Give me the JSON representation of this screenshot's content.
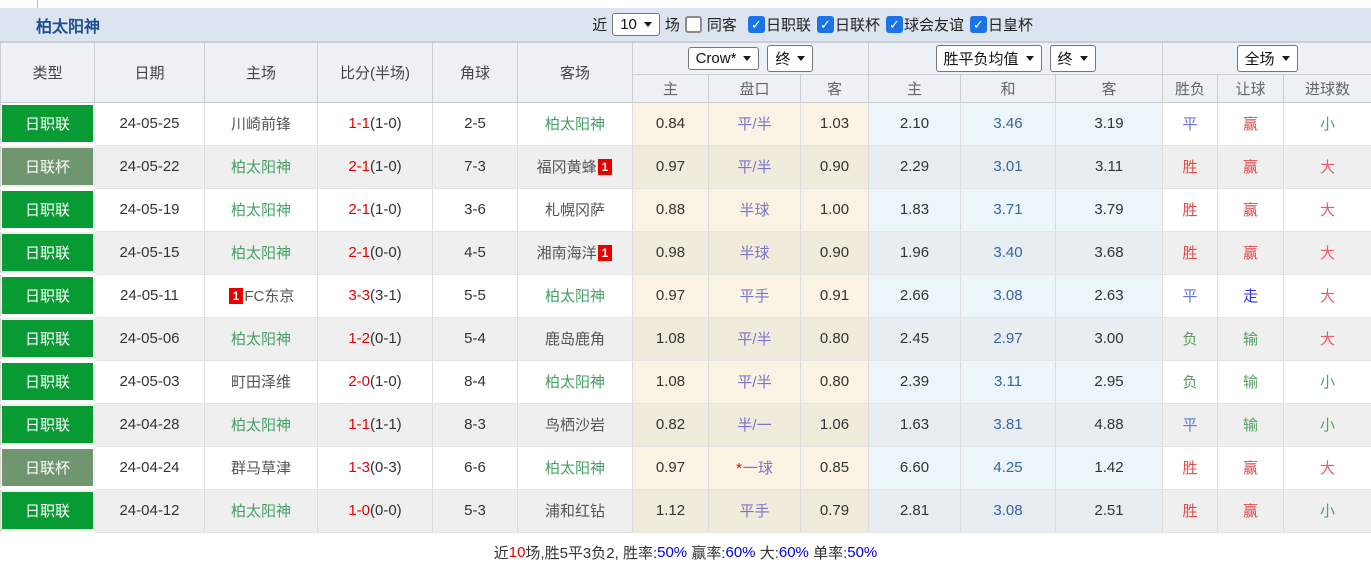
{
  "title": "柏太阳神",
  "toolbar": {
    "recent_label": "近",
    "matches_count": "10",
    "matches_label": "场",
    "same_venue_label": "同客",
    "same_venue_checked": false,
    "filters": [
      {
        "label": "日职联",
        "checked": true
      },
      {
        "label": "日联杯",
        "checked": true
      },
      {
        "label": "球会友谊",
        "checked": true
      },
      {
        "label": "日皇杯",
        "checked": true
      }
    ]
  },
  "header": {
    "type": "类型",
    "date": "日期",
    "home": "主场",
    "score": "比分(半场)",
    "corner": "角球",
    "away": "客场",
    "asian_selects": {
      "company": "Crow*",
      "period": "终"
    },
    "euro_selects": {
      "company": "胜平负均值",
      "period": "终"
    },
    "result_select": "全场",
    "sub": {
      "asian_home": "主",
      "asian_line": "盘口",
      "asian_away": "客",
      "euro_home": "主",
      "euro_draw": "和",
      "euro_away": "客",
      "outcome": "胜负",
      "handicap": "让球",
      "goals": "进球数"
    }
  },
  "rows": [
    {
      "league": "日职联",
      "league_class": "j1",
      "date": "24-05-25",
      "home": {
        "name": "川崎前锋",
        "self": false,
        "card": "",
        "card_pos": ""
      },
      "score": "1-1",
      "half": "(1-0)",
      "corners": "2-5",
      "away": {
        "name": "柏太阳神",
        "self": true,
        "card": "",
        "card_pos": ""
      },
      "asian": {
        "home": "0.84",
        "star": "",
        "line": "平/半",
        "away": "1.03"
      },
      "euro": {
        "home": "2.10",
        "draw": "3.46",
        "away": "3.19"
      },
      "outcome": {
        "text": "平",
        "color": "blue"
      },
      "handicap": {
        "text": "赢",
        "color": "red"
      },
      "goals": {
        "text": "小",
        "color": "green"
      }
    },
    {
      "league": "日联杯",
      "league_class": "cup",
      "date": "24-05-22",
      "home": {
        "name": "柏太阳神",
        "self": true,
        "card": "",
        "card_pos": ""
      },
      "score": "2-1",
      "half": "(1-0)",
      "corners": "7-3",
      "away": {
        "name": "福冈黄蜂",
        "self": false,
        "card": "1",
        "card_pos": "after"
      },
      "asian": {
        "home": "0.97",
        "star": "",
        "line": "平/半",
        "away": "0.90"
      },
      "euro": {
        "home": "2.29",
        "draw": "3.01",
        "away": "3.11"
      },
      "outcome": {
        "text": "胜",
        "color": "red"
      },
      "handicap": {
        "text": "赢",
        "color": "red"
      },
      "goals": {
        "text": "大",
        "color": "red2"
      }
    },
    {
      "league": "日职联",
      "league_class": "j1",
      "date": "24-05-19",
      "home": {
        "name": "柏太阳神",
        "self": true,
        "card": "",
        "card_pos": ""
      },
      "score": "2-1",
      "half": "(1-0)",
      "corners": "3-6",
      "away": {
        "name": "札幌冈萨",
        "self": false,
        "card": "",
        "card_pos": ""
      },
      "asian": {
        "home": "0.88",
        "star": "",
        "line": "半球",
        "away": "1.00"
      },
      "euro": {
        "home": "1.83",
        "draw": "3.71",
        "away": "3.79"
      },
      "outcome": {
        "text": "胜",
        "color": "red"
      },
      "handicap": {
        "text": "赢",
        "color": "red"
      },
      "goals": {
        "text": "大",
        "color": "red2"
      }
    },
    {
      "league": "日职联",
      "league_class": "j1",
      "date": "24-05-15",
      "home": {
        "name": "柏太阳神",
        "self": true,
        "card": "",
        "card_pos": ""
      },
      "score": "2-1",
      "half": "(0-0)",
      "corners": "4-5",
      "away": {
        "name": "湘南海洋",
        "self": false,
        "card": "1",
        "card_pos": "after"
      },
      "asian": {
        "home": "0.98",
        "star": "",
        "line": "半球",
        "away": "0.90"
      },
      "euro": {
        "home": "1.96",
        "draw": "3.40",
        "away": "3.68"
      },
      "outcome": {
        "text": "胜",
        "color": "red"
      },
      "handicap": {
        "text": "赢",
        "color": "red"
      },
      "goals": {
        "text": "大",
        "color": "red2"
      }
    },
    {
      "league": "日职联",
      "league_class": "j1",
      "date": "24-05-11",
      "home": {
        "name": "FC东京",
        "self": false,
        "card": "1",
        "card_pos": "before"
      },
      "score": "3-3",
      "half": "(3-1)",
      "corners": "5-5",
      "away": {
        "name": "柏太阳神",
        "self": true,
        "card": "",
        "card_pos": ""
      },
      "asian": {
        "home": "0.97",
        "star": "",
        "line": "平手",
        "away": "0.91"
      },
      "euro": {
        "home": "2.66",
        "draw": "3.08",
        "away": "2.63"
      },
      "outcome": {
        "text": "平",
        "color": "blue"
      },
      "handicap": {
        "text": "走",
        "color": "blue2"
      },
      "goals": {
        "text": "大",
        "color": "red2"
      }
    },
    {
      "league": "日职联",
      "league_class": "j1",
      "date": "24-05-06",
      "home": {
        "name": "柏太阳神",
        "self": true,
        "card": "",
        "card_pos": ""
      },
      "score": "1-2",
      "half": "(0-1)",
      "corners": "5-4",
      "away": {
        "name": "鹿岛鹿角",
        "self": false,
        "card": "",
        "card_pos": ""
      },
      "asian": {
        "home": "1.08",
        "star": "",
        "line": "平/半",
        "away": "0.80"
      },
      "euro": {
        "home": "2.45",
        "draw": "2.97",
        "away": "3.00"
      },
      "outcome": {
        "text": "负",
        "color": "green"
      },
      "handicap": {
        "text": "输",
        "color": "green"
      },
      "goals": {
        "text": "大",
        "color": "red2"
      }
    },
    {
      "league": "日职联",
      "league_class": "j1",
      "date": "24-05-03",
      "home": {
        "name": "町田泽维",
        "self": false,
        "card": "",
        "card_pos": ""
      },
      "score": "2-0",
      "half": "(1-0)",
      "corners": "8-4",
      "away": {
        "name": "柏太阳神",
        "self": true,
        "card": "",
        "card_pos": ""
      },
      "asian": {
        "home": "1.08",
        "star": "",
        "line": "平/半",
        "away": "0.80"
      },
      "euro": {
        "home": "2.39",
        "draw": "3.11",
        "away": "2.95"
      },
      "outcome": {
        "text": "负",
        "color": "green"
      },
      "handicap": {
        "text": "输",
        "color": "green"
      },
      "goals": {
        "text": "小",
        "color": "green"
      }
    },
    {
      "league": "日职联",
      "league_class": "j1",
      "date": "24-04-28",
      "home": {
        "name": "柏太阳神",
        "self": true,
        "card": "",
        "card_pos": ""
      },
      "score": "1-1",
      "half": "(1-1)",
      "corners": "8-3",
      "away": {
        "name": "鸟栖沙岩",
        "self": false,
        "card": "",
        "card_pos": ""
      },
      "asian": {
        "home": "0.82",
        "star": "",
        "line": "半/一",
        "away": "1.06"
      },
      "euro": {
        "home": "1.63",
        "draw": "3.81",
        "away": "4.88"
      },
      "outcome": {
        "text": "平",
        "color": "blue"
      },
      "handicap": {
        "text": "输",
        "color": "green"
      },
      "goals": {
        "text": "小",
        "color": "green"
      }
    },
    {
      "league": "日联杯",
      "league_class": "cup",
      "date": "24-04-24",
      "home": {
        "name": "群马草津",
        "self": false,
        "card": "",
        "card_pos": ""
      },
      "score": "1-3",
      "half": "(0-3)",
      "corners": "6-6",
      "away": {
        "name": "柏太阳神",
        "self": true,
        "card": "",
        "card_pos": ""
      },
      "asian": {
        "home": "0.97",
        "star": "*",
        "line": "一球",
        "away": "0.85"
      },
      "euro": {
        "home": "6.60",
        "draw": "4.25",
        "away": "1.42"
      },
      "outcome": {
        "text": "胜",
        "color": "red"
      },
      "handicap": {
        "text": "赢",
        "color": "red"
      },
      "goals": {
        "text": "大",
        "color": "red2"
      }
    },
    {
      "league": "日职联",
      "league_class": "j1",
      "date": "24-04-12",
      "home": {
        "name": "柏太阳神",
        "self": true,
        "card": "",
        "card_pos": ""
      },
      "score": "1-0",
      "half": "(0-0)",
      "corners": "5-3",
      "away": {
        "name": "浦和红钻",
        "self": false,
        "card": "",
        "card_pos": ""
      },
      "asian": {
        "home": "1.12",
        "star": "",
        "line": "平手",
        "away": "0.79"
      },
      "euro": {
        "home": "2.81",
        "draw": "3.08",
        "away": "2.51"
      },
      "outcome": {
        "text": "胜",
        "color": "red"
      },
      "handicap": {
        "text": "赢",
        "color": "red"
      },
      "goals": {
        "text": "小",
        "color": "green"
      }
    }
  ],
  "footer": {
    "segments": [
      {
        "text": "近",
        "color": "dark"
      },
      {
        "text": "10",
        "color": "red"
      },
      {
        "text": "场,胜5平3负2, 胜率:",
        "color": "dark"
      },
      {
        "text": "50%",
        "color": "blue"
      },
      {
        "text": " 赢率:",
        "color": "dark"
      },
      {
        "text": "60%",
        "color": "blue"
      },
      {
        "text": " 大:",
        "color": "dark"
      },
      {
        "text": "60%",
        "color": "blue"
      },
      {
        "text": " 单率:",
        "color": "dark"
      },
      {
        "text": "50%",
        "color": "blue"
      }
    ]
  }
}
